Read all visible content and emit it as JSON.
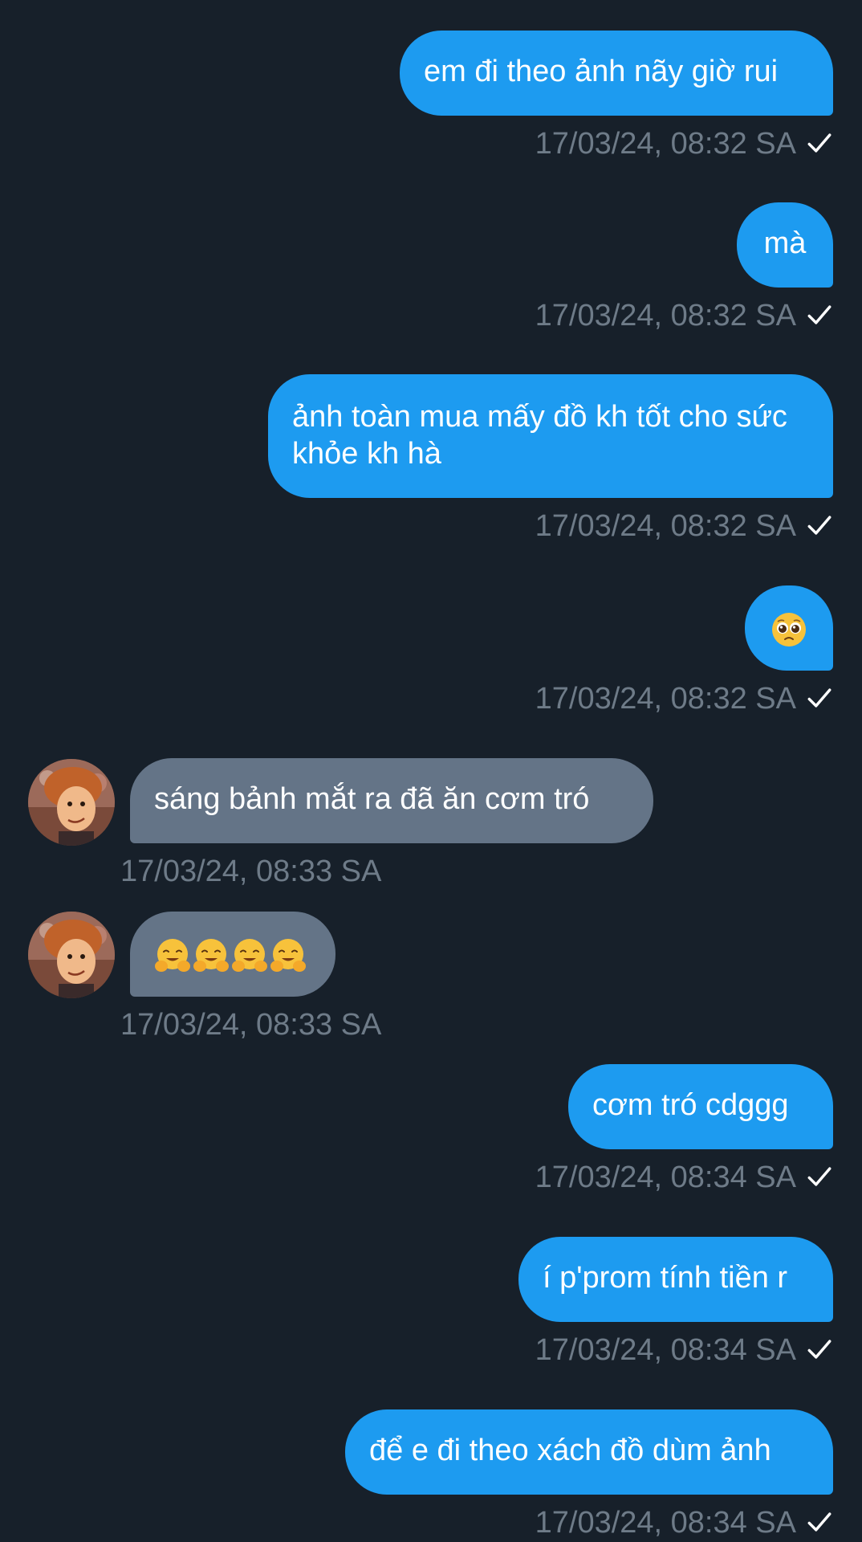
{
  "colors": {
    "background": "#17202a",
    "outgoing_bubble": "#1d9bf0",
    "incoming_bubble": "#647487",
    "timestamp": "#6e7b88",
    "text": "#ffffff"
  },
  "messages": [
    {
      "direction": "out",
      "text": "em đi theo ảnh nãy giờ rui",
      "time": "17/03/24, 08:32 SA",
      "read": true
    },
    {
      "direction": "out",
      "text": "mà",
      "time": "17/03/24, 08:32 SA",
      "read": true
    },
    {
      "direction": "out",
      "text": "ảnh toàn mua mấy đồ kh tốt cho sức khỏe kh hà",
      "time": "17/03/24, 08:32 SA",
      "read": true
    },
    {
      "direction": "out",
      "emoji": "pleading-face-icon",
      "text": "",
      "time": "17/03/24, 08:32 SA",
      "read": true
    },
    {
      "direction": "in",
      "text": "sáng bảnh mắt ra đã ăn cơm tró",
      "time": "17/03/24, 08:33 SA"
    },
    {
      "direction": "in",
      "emoji": "hugging-face-icon",
      "emoji_count": 4,
      "text": "",
      "time": "17/03/24, 08:33 SA"
    },
    {
      "direction": "out",
      "text": "cơm tró cdggg",
      "time": "17/03/24, 08:34 SA",
      "read": true
    },
    {
      "direction": "out",
      "text": "í p'prom tính tiền r",
      "time": "17/03/24, 08:34 SA",
      "read": true
    },
    {
      "direction": "out",
      "text": "để e đi theo xách đồ dùm ảnh",
      "time": "17/03/24, 08:34 SA",
      "read": true
    }
  ]
}
